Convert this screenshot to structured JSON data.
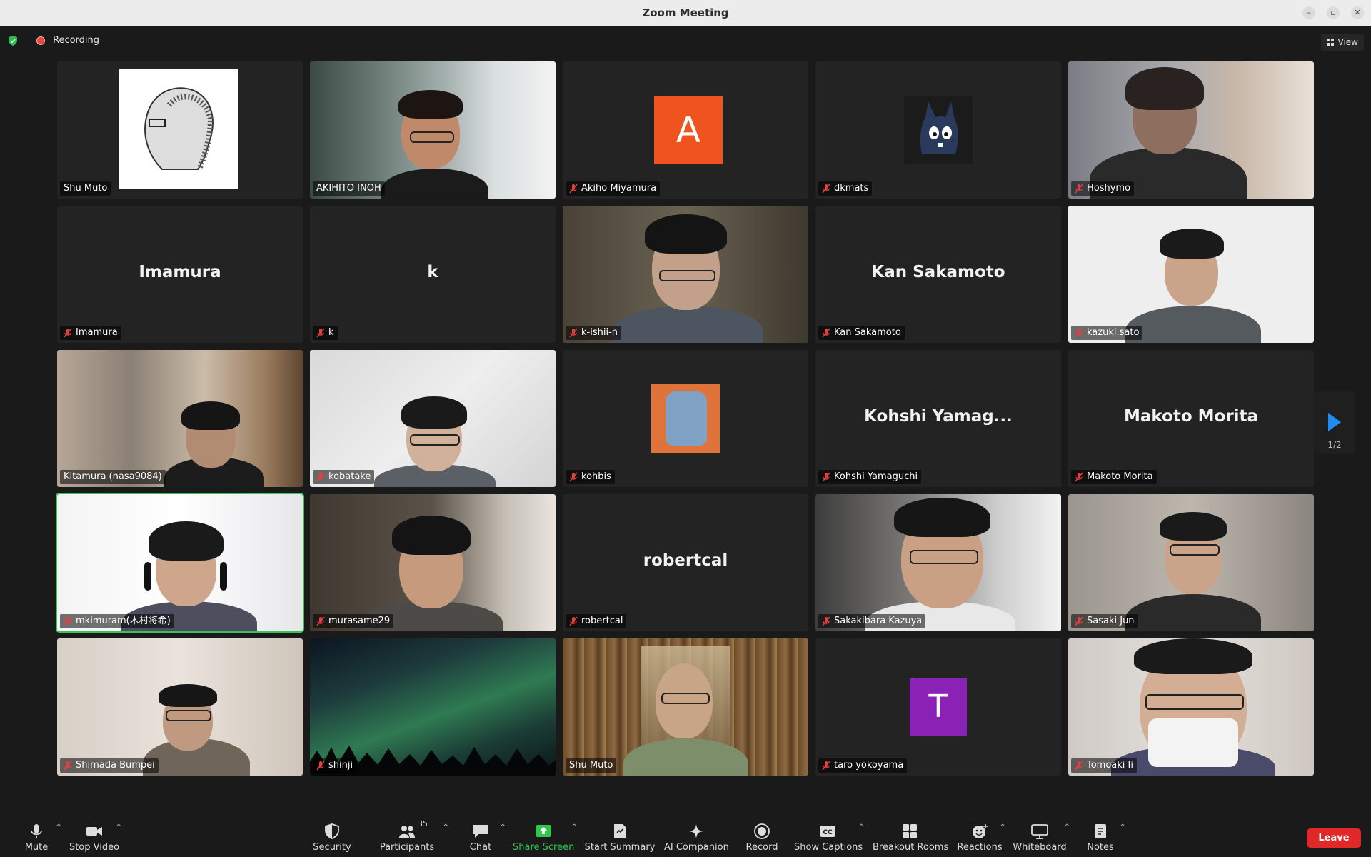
{
  "window": {
    "title": "Zoom Meeting"
  },
  "topbar": {
    "recording_label": "Recording",
    "view_label": "View"
  },
  "participants": [
    {
      "label": "Shu Muto",
      "muted": false
    },
    {
      "label": "AKIHITO INOH",
      "muted": false
    },
    {
      "label": "Akiho Miyamura",
      "muted": true,
      "avatar": "A",
      "avatar_color": "#f0541e"
    },
    {
      "label": "dkmats",
      "muted": true
    },
    {
      "label": "Hoshymo",
      "muted": true
    },
    {
      "label": "Imamura",
      "muted": true,
      "big": "Imamura"
    },
    {
      "label": "k",
      "muted": true,
      "big": "k"
    },
    {
      "label": "k-ishii-n",
      "muted": true
    },
    {
      "label": "Kan Sakamoto",
      "muted": true,
      "big": "Kan Sakamoto"
    },
    {
      "label": "kazuki.sato",
      "muted": true
    },
    {
      "label": "Kitamura (nasa9084)",
      "muted": false
    },
    {
      "label": "kobatake",
      "muted": true
    },
    {
      "label": "kohbis",
      "muted": true
    },
    {
      "label": "Kohshi Yamaguchi",
      "muted": true,
      "big": "Kohshi Yamag..."
    },
    {
      "label": "Makoto Morita",
      "muted": true,
      "big": "Makoto Morita"
    },
    {
      "label": "mkimuram(木村将希)",
      "muted": true,
      "active": true
    },
    {
      "label": "murasame29",
      "muted": true
    },
    {
      "label": "robertcal",
      "muted": true,
      "big": "robertcal"
    },
    {
      "label": "Sakakibara Kazuya",
      "muted": true
    },
    {
      "label": "Sasaki Jun",
      "muted": true
    },
    {
      "label": "Shimada Bumpei",
      "muted": true
    },
    {
      "label": "shinji",
      "muted": true
    },
    {
      "label": "Shu Muto",
      "muted": false
    },
    {
      "label": "taro yokoyama",
      "muted": true,
      "avatar": "T",
      "avatar_color": "#8a23b5"
    },
    {
      "label": "Tomoaki Ii",
      "muted": true
    }
  ],
  "pager": {
    "page": "1/2"
  },
  "toolbar": {
    "mute": "Mute",
    "stop_video": "Stop Video",
    "security": "Security",
    "participants": "Participants",
    "participants_count": "35",
    "chat": "Chat",
    "share_screen": "Share Screen",
    "start_summary": "Start Summary",
    "ai_companion": "AI Companion",
    "record": "Record",
    "show_captions": "Show Captions",
    "breakout_rooms": "Breakout Rooms",
    "reactions": "Reactions",
    "whiteboard": "Whiteboard",
    "notes": "Notes",
    "leave": "Leave"
  },
  "colors": {
    "share_green": "#31c74b",
    "leave_red": "#e02828",
    "active_border": "#35c35a",
    "pager_blue": "#1e8cf2"
  }
}
